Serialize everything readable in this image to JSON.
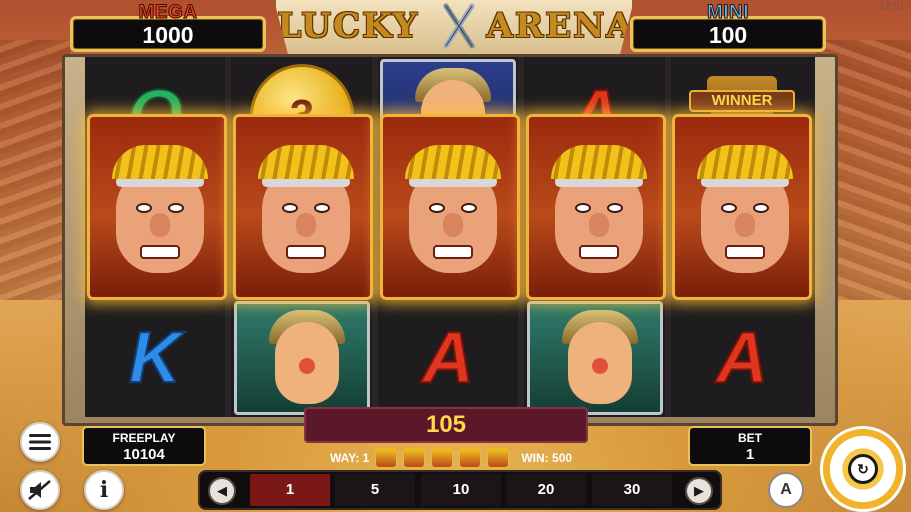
{
  "clock": "17:01",
  "jackpots": {
    "mega": {
      "label": "MEGA",
      "value": "1000"
    },
    "mini": {
      "label": "MINI",
      "value": "100"
    }
  },
  "logo": {
    "left_text": "LUCKY",
    "right_text": "ARENA"
  },
  "reels": [
    [
      "Q",
      "CAESAR",
      "K"
    ],
    [
      "3",
      "CAESAR",
      "GLADIATOR_GREEN"
    ],
    [
      "GLADIATOR_BLUE",
      "CAESAR",
      "A"
    ],
    [
      "A",
      "CAESAR",
      "GLADIATOR_GREEN"
    ],
    [
      "WINNER",
      "CAESAR",
      "A"
    ]
  ],
  "symbols": {
    "coin_value": "3",
    "trophy_label": "WINNER"
  },
  "win": {
    "amount": "105",
    "way_label": "WAY: 1",
    "win_label": "WIN: 500"
  },
  "freeplay": {
    "label": "FREEPLAY",
    "value": "10104"
  },
  "bet": {
    "label": "BET",
    "value": "1",
    "options": [
      "1",
      "5",
      "10",
      "20",
      "30"
    ],
    "selected": "1"
  },
  "icons": {
    "menu": "menu-icon",
    "sound": "sound-off-icon",
    "info": "info-icon",
    "prev": "chevron-left-icon",
    "next": "chevron-right-icon",
    "auto": "autoplay-icon",
    "spin": "spin-icon"
  },
  "colors": {
    "mega": "#ff3b2d",
    "mini": "#4fc2ff",
    "gold": "#e7c35a",
    "win_text": "#ffd84a",
    "selected_bet": "#7a1818"
  }
}
